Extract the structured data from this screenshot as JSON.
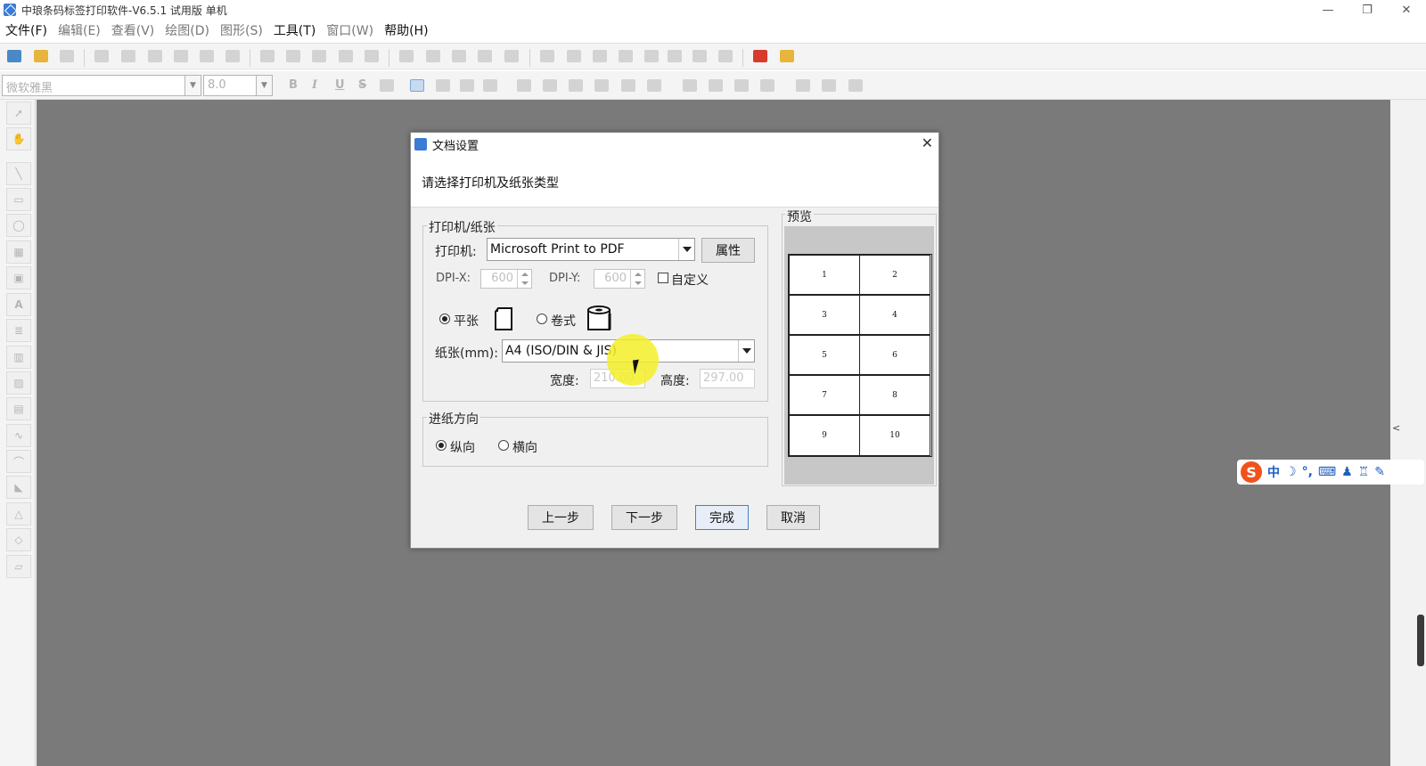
{
  "window": {
    "title": "中琅条码标签打印软件-V6.5.1 试用版 单机",
    "controls": [
      "—",
      "❐",
      "✕"
    ]
  },
  "menu": [
    {
      "label": "文件(F)",
      "dim": false
    },
    {
      "label": "编辑(E)",
      "dim": true
    },
    {
      "label": "查看(V)",
      "dim": true
    },
    {
      "label": "绘图(D)",
      "dim": true
    },
    {
      "label": "图形(S)",
      "dim": true
    },
    {
      "label": "工具(T)",
      "dim": false
    },
    {
      "label": "窗口(W)",
      "dim": true
    },
    {
      "label": "帮助(H)",
      "dim": false
    }
  ],
  "format_bar": {
    "font": "微软雅黑",
    "size": "8.0",
    "bold": "B",
    "italic": "I",
    "underline": "U",
    "strike": "S"
  },
  "ime": {
    "logo": "S",
    "mode": "中"
  },
  "dialog": {
    "title": "文档设置",
    "close": "✕",
    "header": "请选择打印机及纸张类型",
    "printer_group": "打印机/纸张",
    "printer_label": "打印机:",
    "printer_value": "Microsoft Print to PDF",
    "properties_btn": "属性",
    "dpi_x_label": "DPI-X:",
    "dpi_x_value": "600",
    "dpi_y_label": "DPI-Y:",
    "dpi_y_value": "600",
    "custom_label": "自定义",
    "flat_label": "平张",
    "roll_label": "卷式",
    "paper_label": "纸张(mm):",
    "paper_value": "A4 (ISO/DIN & JIS)",
    "width_label": "宽度:",
    "width_value": "210.00",
    "height_label": "高度:",
    "height_value": "297.00",
    "feed_group": "进纸方向",
    "portrait_label": "纵向",
    "landscape_label": "横向",
    "preview_label": "预览",
    "preview_cells": [
      "1",
      "2",
      "3",
      "4",
      "5",
      "6",
      "7",
      "8",
      "9",
      "10"
    ],
    "prev_btn": "上一步",
    "next_btn": "下一步",
    "finish_btn": "完成",
    "cancel_btn": "取消"
  }
}
